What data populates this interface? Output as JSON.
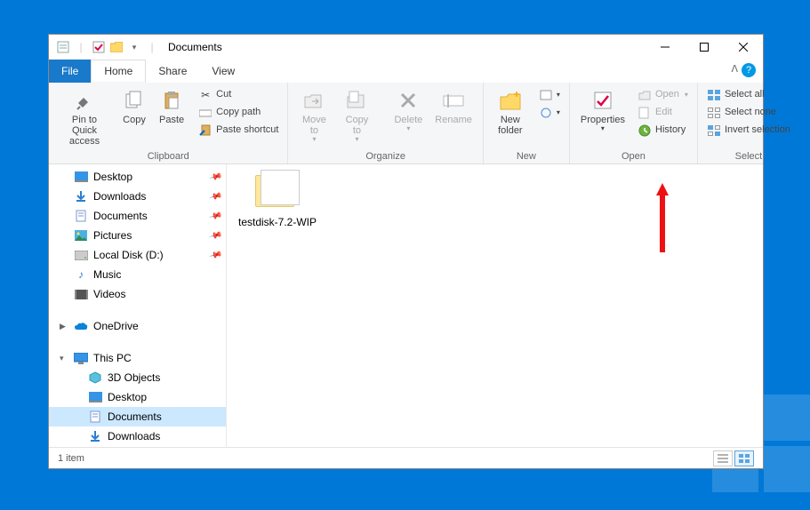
{
  "titlebar": {
    "title": "Documents"
  },
  "tabs": {
    "file": "File",
    "home": "Home",
    "share": "Share",
    "view": "View"
  },
  "ribbon": {
    "clipboard": {
      "label": "Clipboard",
      "pin": "Pin to Quick access",
      "copy": "Copy",
      "paste": "Paste",
      "cut": "Cut",
      "copy_path": "Copy path",
      "paste_shortcut": "Paste shortcut"
    },
    "organize": {
      "label": "Organize",
      "move_to": "Move to",
      "copy_to": "Copy to",
      "delete": "Delete",
      "rename": "Rename"
    },
    "new": {
      "label": "New",
      "new_folder": "New folder"
    },
    "open": {
      "label": "Open",
      "properties": "Properties",
      "open": "Open",
      "edit": "Edit",
      "history": "History"
    },
    "select": {
      "label": "Select",
      "select_all": "Select all",
      "select_none": "Select none",
      "invert": "Invert selection"
    }
  },
  "sidebar": {
    "quick": [
      {
        "label": "Desktop",
        "pin": true
      },
      {
        "label": "Downloads",
        "pin": true
      },
      {
        "label": "Documents",
        "pin": true
      },
      {
        "label": "Pictures",
        "pin": true
      },
      {
        "label": "Local Disk (D:)",
        "pin": true
      },
      {
        "label": "Music",
        "pin": false
      },
      {
        "label": "Videos",
        "pin": false
      }
    ],
    "onedrive": "OneDrive",
    "thispc": "This PC",
    "pc_items": [
      {
        "label": "3D Objects"
      },
      {
        "label": "Desktop"
      },
      {
        "label": "Documents",
        "selected": true
      },
      {
        "label": "Downloads"
      }
    ]
  },
  "files": {
    "item0": "testdisk-7.2-WIP"
  },
  "status": {
    "count": "1 item"
  }
}
